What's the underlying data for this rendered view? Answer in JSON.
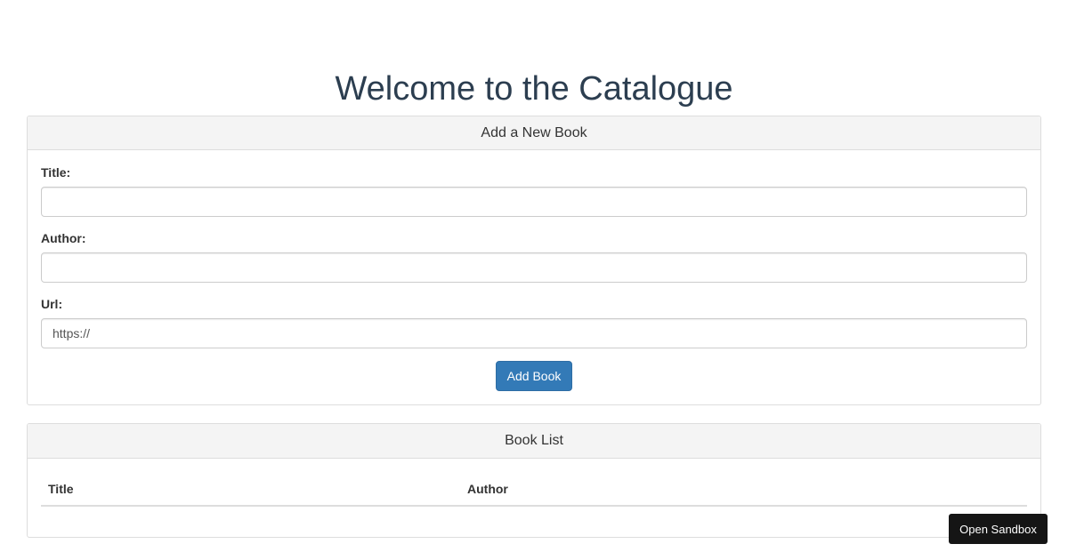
{
  "page": {
    "title": "Welcome to the Catalogue"
  },
  "add_book_panel": {
    "heading": "Add a New Book",
    "fields": [
      {
        "label": "Title:",
        "value": "",
        "placeholder": ""
      },
      {
        "label": "Author:",
        "value": "",
        "placeholder": ""
      },
      {
        "label": "Url:",
        "value": "https://",
        "placeholder": ""
      }
    ],
    "submit_label": "Add Book"
  },
  "book_list_panel": {
    "heading": "Book List",
    "columns": [
      "Title",
      "Author"
    ],
    "rows": []
  },
  "sandbox_button_label": "Open Sandbox",
  "colors": {
    "primary_button": "#337ab7",
    "heading_text": "#2c3e50",
    "panel_heading_bg": "#f4f4f4",
    "sandbox_button_bg": "#151515"
  }
}
